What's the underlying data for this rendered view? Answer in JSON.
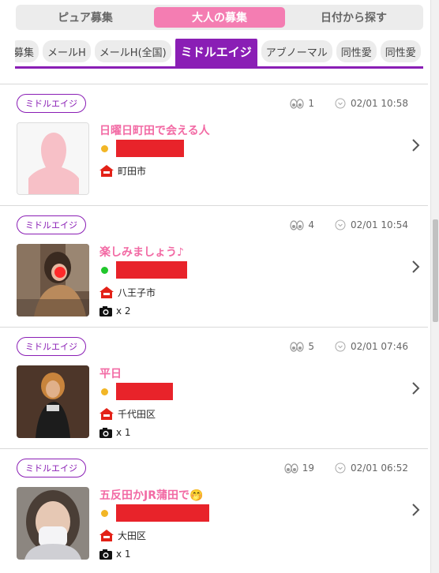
{
  "top_tabs": [
    "ピュア募集",
    "大人の募集",
    "日付から探す"
  ],
  "category_tabs": [
    "募集",
    "メールH",
    "メールH(全国)",
    "ミドルエイジ",
    "アブノーマル",
    "同性愛",
    "同性愛"
  ],
  "colors": {
    "accent_pink": "#f47db2",
    "title_pink": "#f26aa4",
    "purple": "#8a1eb5",
    "redaction": "#e8232a"
  },
  "posts": [
    {
      "badge": "ミドルエイジ",
      "views": "1",
      "datetime": "02/01 10:58",
      "title": "日曜日町田で会える人",
      "status_color": "#f2b626",
      "location": "町田市",
      "photos": ""
    },
    {
      "badge": "ミドルエイジ",
      "views": "4",
      "datetime": "02/01 10:54",
      "title": "楽しみましょう♪",
      "status_color": "#21c72c",
      "location": "八王子市",
      "photos": "x 2"
    },
    {
      "badge": "ミドルエイジ",
      "views": "5",
      "datetime": "02/01 07:46",
      "title": "平日",
      "status_color": "#f2b626",
      "location": "千代田区",
      "photos": "x 1"
    },
    {
      "badge": "ミドルエイジ",
      "views": "19",
      "datetime": "02/01 06:52",
      "title": "五反田かJR蒲田で",
      "title_emoji": "🤭",
      "status_color": "#f2b626",
      "location": "大田区",
      "photos": "x 1"
    }
  ]
}
